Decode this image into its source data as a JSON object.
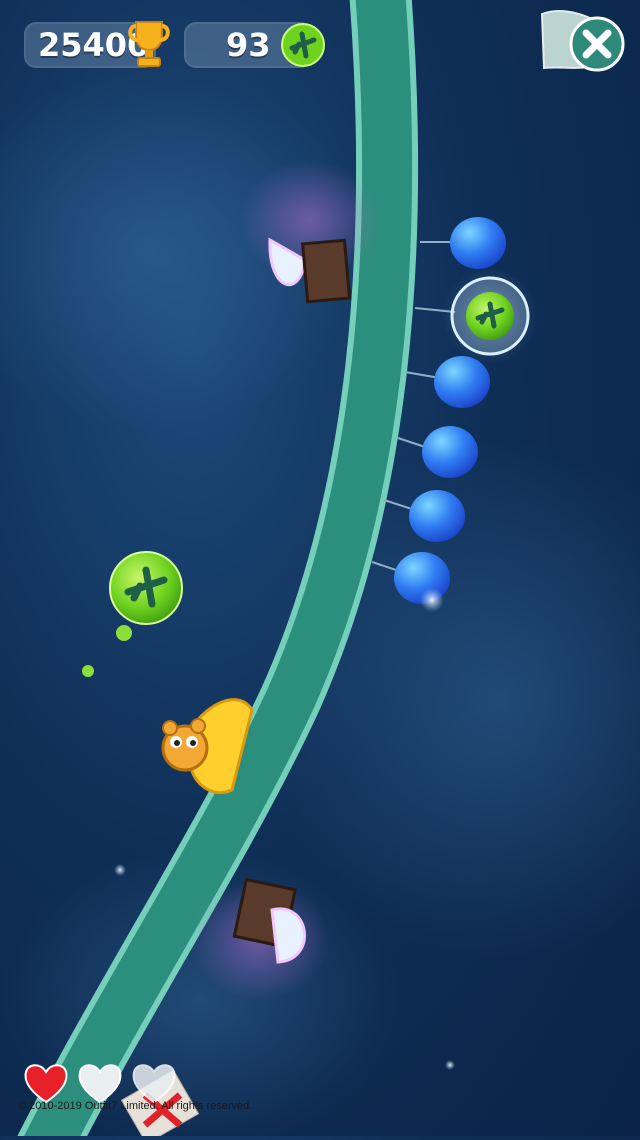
{
  "hud": {
    "score": "25400",
    "coins": "93",
    "score_icon": "trophy-icon",
    "coin_icon": "plane-coin-icon",
    "close_icon": "close-icon"
  },
  "lives": {
    "filled": 1,
    "total": 3
  },
  "footer": {
    "copyright": "2010-2019 Outfit7 Limited. All rights reserved."
  },
  "colors": {
    "sky": "#0f2f57",
    "track": "#2fa98f",
    "balloon": "#2f7bf2",
    "coin": "#6fd21f",
    "heart": "#e8202a"
  }
}
